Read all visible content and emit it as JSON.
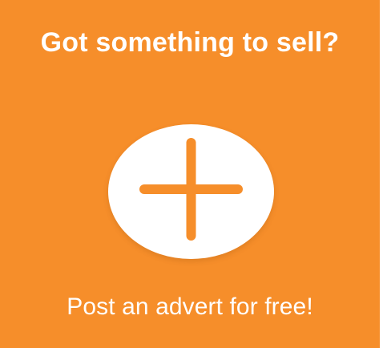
{
  "promo": {
    "headline": "Got something to sell?",
    "cta_text": "Post an advert for free!",
    "background_color": "#f68e2a",
    "button_icon": "plus-icon"
  }
}
